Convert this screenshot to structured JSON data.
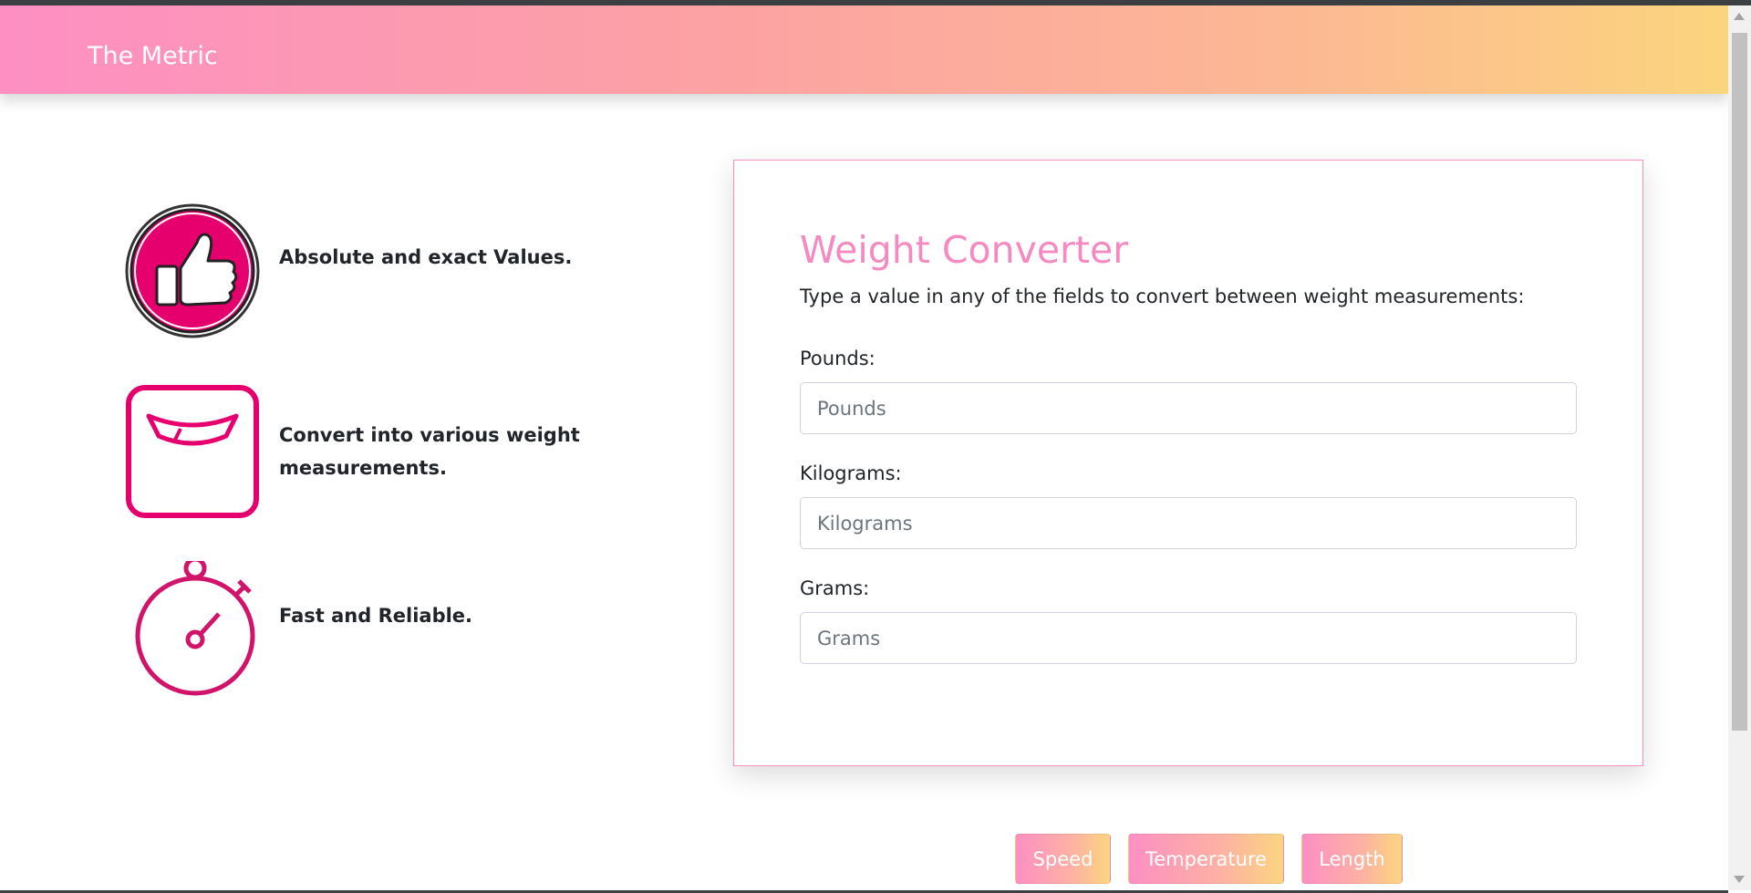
{
  "header": {
    "brand": "The Metric"
  },
  "features": [
    {
      "icon": "thumbs-up-icon",
      "text": "Absolute and exact Values."
    },
    {
      "icon": "scale-icon",
      "text": "Convert into various weight measurements."
    },
    {
      "icon": "stopwatch-icon",
      "text": "Fast and Reliable."
    }
  ],
  "converter": {
    "title": "Weight Converter",
    "description": "Type a value in any of the fields to convert between weight measurements:",
    "fields": [
      {
        "label": "Pounds:",
        "placeholder": "Pounds",
        "value": ""
      },
      {
        "label": "Kilograms:",
        "placeholder": "Kilograms",
        "value": ""
      },
      {
        "label": "Grams:",
        "placeholder": "Grams",
        "value": ""
      }
    ]
  },
  "nav_buttons": [
    "Speed",
    "Temperature",
    "Length"
  ],
  "colors": {
    "accent": "#e6006e",
    "title": "#f58ac0",
    "gradient_start": "#fd8fc3",
    "gradient_end": "#fbd57e"
  }
}
